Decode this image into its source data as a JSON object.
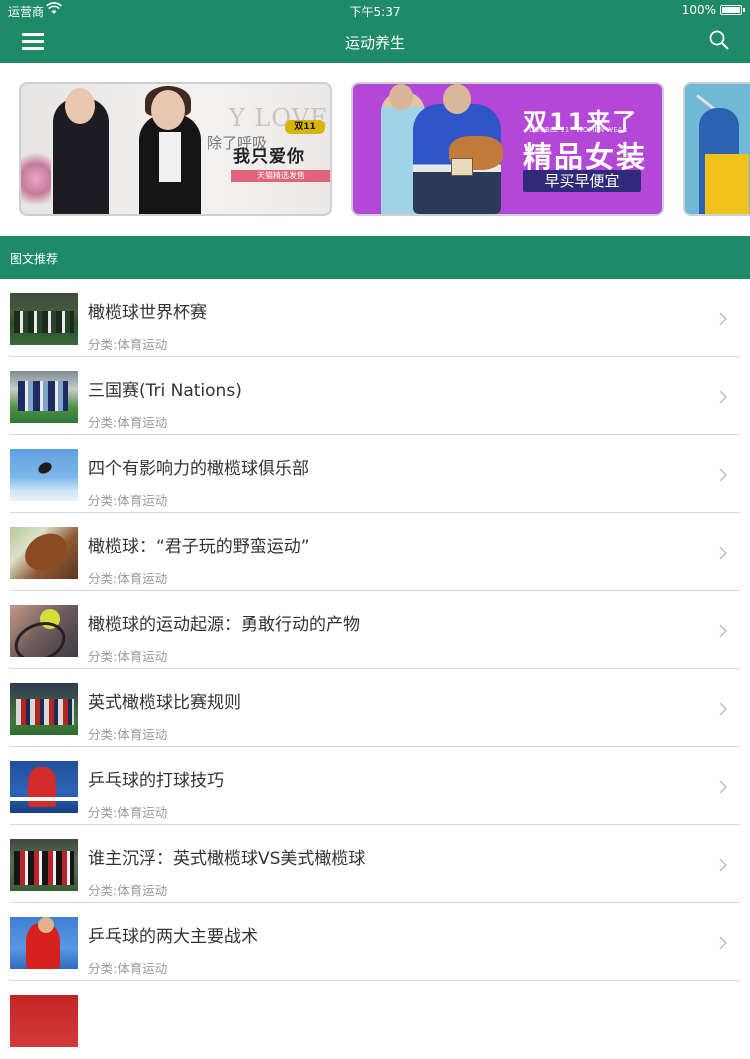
{
  "status_bar": {
    "carrier": "运营商",
    "time": "下午5:37",
    "battery": "100%"
  },
  "nav": {
    "title": "运动养生",
    "menu_icon": "menu-icon",
    "search_icon": "search-icon"
  },
  "banners": {
    "banner1": {
      "big_text": "Y LOVE",
      "sub_text": "除了呼吸",
      "main_text": "我只爱你",
      "tag_text": "天猫精选发售",
      "badge_text": "双11"
    },
    "banner2": {
      "title1": "双11来了",
      "small_text": "DOUBLE 11 · WOMEN WEAR",
      "title2": "精品女装",
      "cta": "早买早便宜"
    }
  },
  "section": {
    "title": "图文推荐"
  },
  "items": [
    {
      "title": "橄榄球世界杯赛",
      "category": "分类:体育运动"
    },
    {
      "title": "三国赛(Tri Nations)",
      "category": "分类:体育运动"
    },
    {
      "title": "四个有影响力的橄榄球俱乐部",
      "category": "分类:体育运动"
    },
    {
      "title": "橄榄球：“君子玩的野蛮运动”",
      "category": "分类:体育运动"
    },
    {
      "title": "橄榄球的运动起源：勇敢行动的产物",
      "category": "分类:体育运动"
    },
    {
      "title": "英式橄榄球比赛规则",
      "category": "分类:体育运动"
    },
    {
      "title": "乒乓球的打球技巧",
      "category": "分类:体育运动"
    },
    {
      "title": "谁主沉浮：英式橄榄球VS美式橄榄球",
      "category": "分类:体育运动"
    },
    {
      "title": "乒乓球的两大主要战术",
      "category": "分类:体育运动"
    }
  ],
  "colors": {
    "accent": "#1e8a68",
    "title_text": "#333333",
    "category_text": "#999999",
    "separator": "#d8d8d8"
  }
}
